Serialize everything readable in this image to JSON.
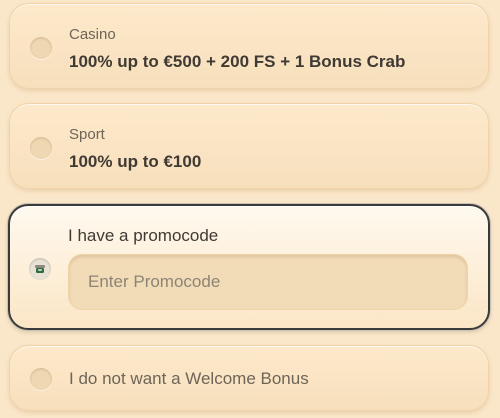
{
  "options": [
    {
      "category": "Casino",
      "offer": "100% up to €500 + 200 FS + 1 Bonus Crab"
    },
    {
      "category": "Sport",
      "offer": "100% up to €100"
    }
  ],
  "promocode": {
    "label": "I have a promocode",
    "placeholder": "Enter Promocode",
    "value": ""
  },
  "no_bonus": {
    "label": "I do not want a Welcome Bonus"
  },
  "selected_option": "promocode",
  "colors": {
    "background": "#fae6c8",
    "card": "#f7dfbc",
    "selected_border": "#3a3a3a",
    "text_primary": "#3f3a33",
    "text_secondary": "#6e6558",
    "radio_check": "#2e6b3f"
  }
}
